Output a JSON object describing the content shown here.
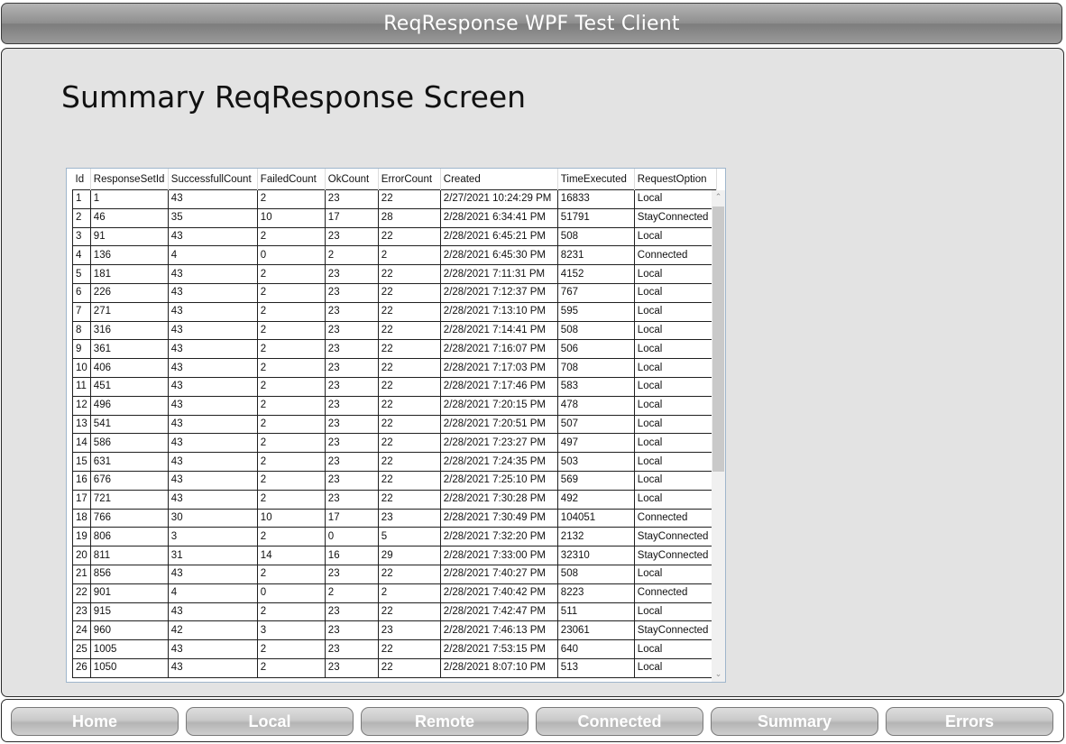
{
  "window": {
    "title": "ReqResponse WPF Test Client"
  },
  "page": {
    "title": "Summary ReqResponse Screen"
  },
  "grid": {
    "columns": [
      "Id",
      "ResponseSetId",
      "SuccessfullCount",
      "FailedCount",
      "OkCount",
      "ErrorCount",
      "Created",
      "TimeExecuted",
      "RequestOption"
    ],
    "rows": [
      [
        "1",
        "1",
        "43",
        "2",
        "23",
        "22",
        "2/27/2021 10:24:29 PM",
        "16833",
        "Local"
      ],
      [
        "2",
        "46",
        "35",
        "10",
        "17",
        "28",
        "2/28/2021 6:34:41 PM",
        "51791",
        "StayConnected"
      ],
      [
        "3",
        "91",
        "43",
        "2",
        "23",
        "22",
        "2/28/2021 6:45:21 PM",
        "508",
        "Local"
      ],
      [
        "4",
        "136",
        "4",
        "0",
        "2",
        "2",
        "2/28/2021 6:45:30 PM",
        "8231",
        "Connected"
      ],
      [
        "5",
        "181",
        "43",
        "2",
        "23",
        "22",
        "2/28/2021 7:11:31 PM",
        "4152",
        "Local"
      ],
      [
        "6",
        "226",
        "43",
        "2",
        "23",
        "22",
        "2/28/2021 7:12:37 PM",
        "767",
        "Local"
      ],
      [
        "7",
        "271",
        "43",
        "2",
        "23",
        "22",
        "2/28/2021 7:13:10 PM",
        "595",
        "Local"
      ],
      [
        "8",
        "316",
        "43",
        "2",
        "23",
        "22",
        "2/28/2021 7:14:41 PM",
        "508",
        "Local"
      ],
      [
        "9",
        "361",
        "43",
        "2",
        "23",
        "22",
        "2/28/2021 7:16:07 PM",
        "506",
        "Local"
      ],
      [
        "10",
        "406",
        "43",
        "2",
        "23",
        "22",
        "2/28/2021 7:17:03 PM",
        "708",
        "Local"
      ],
      [
        "11",
        "451",
        "43",
        "2",
        "23",
        "22",
        "2/28/2021 7:17:46 PM",
        "583",
        "Local"
      ],
      [
        "12",
        "496",
        "43",
        "2",
        "23",
        "22",
        "2/28/2021 7:20:15 PM",
        "478",
        "Local"
      ],
      [
        "13",
        "541",
        "43",
        "2",
        "23",
        "22",
        "2/28/2021 7:20:51 PM",
        "507",
        "Local"
      ],
      [
        "14",
        "586",
        "43",
        "2",
        "23",
        "22",
        "2/28/2021 7:23:27 PM",
        "497",
        "Local"
      ],
      [
        "15",
        "631",
        "43",
        "2",
        "23",
        "22",
        "2/28/2021 7:24:35 PM",
        "503",
        "Local"
      ],
      [
        "16",
        "676",
        "43",
        "2",
        "23",
        "22",
        "2/28/2021 7:25:10 PM",
        "569",
        "Local"
      ],
      [
        "17",
        "721",
        "43",
        "2",
        "23",
        "22",
        "2/28/2021 7:30:28 PM",
        "492",
        "Local"
      ],
      [
        "18",
        "766",
        "30",
        "10",
        "17",
        "23",
        "2/28/2021 7:30:49 PM",
        "104051",
        "Connected"
      ],
      [
        "19",
        "806",
        "3",
        "2",
        "0",
        "5",
        "2/28/2021 7:32:20 PM",
        "2132",
        "StayConnected"
      ],
      [
        "20",
        "811",
        "31",
        "14",
        "16",
        "29",
        "2/28/2021 7:33:00 PM",
        "32310",
        "StayConnected"
      ],
      [
        "21",
        "856",
        "43",
        "2",
        "23",
        "22",
        "2/28/2021 7:40:27 PM",
        "508",
        "Local"
      ],
      [
        "22",
        "901",
        "4",
        "0",
        "2",
        "2",
        "2/28/2021 7:40:42 PM",
        "8223",
        "Connected"
      ],
      [
        "23",
        "915",
        "43",
        "2",
        "23",
        "22",
        "2/28/2021 7:42:47 PM",
        "511",
        "Local"
      ],
      [
        "24",
        "960",
        "42",
        "3",
        "23",
        "23",
        "2/28/2021 7:46:13 PM",
        "23061",
        "StayConnected"
      ],
      [
        "25",
        "1005",
        "43",
        "2",
        "23",
        "22",
        "2/28/2021 7:53:15 PM",
        "640",
        "Local"
      ],
      [
        "26",
        "1050",
        "43",
        "2",
        "23",
        "22",
        "2/28/2021 8:07:10 PM",
        "513",
        "Local"
      ]
    ],
    "scroll_icons": {
      "up": "scroll-up-arrow-icon",
      "down": "scroll-down-arrow-icon"
    }
  },
  "nav": {
    "buttons": [
      "Home",
      "Local",
      "Remote",
      "Connected",
      "Summary",
      "Errors"
    ]
  }
}
